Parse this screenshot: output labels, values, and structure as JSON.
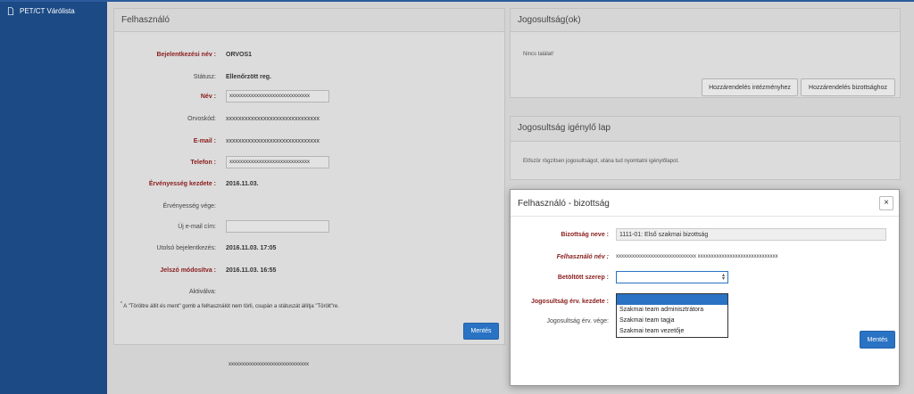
{
  "sidebar": {
    "items": [
      {
        "label": "PET/CT Várólista",
        "icon": "document-icon"
      }
    ]
  },
  "user_panel": {
    "title": "Felhasználó",
    "fields": [
      {
        "label": "Bejelentkezési név :",
        "value": "ORVOS1"
      },
      {
        "label": "Státusz:",
        "value": "Ellenőrzött reg."
      },
      {
        "label": "Név :",
        "value": "xxxxxxxxxxxxxxxxxxxxxxxxxxxxxx"
      },
      {
        "label": "Orvoskód:",
        "value": "xxxxxxxxxxxxxxxxxxxxxxxxxxxxxx"
      },
      {
        "label": "E-mail :",
        "value": "xxxxxxxxxxxxxxxxxxxxxxxxxxxxxx"
      },
      {
        "label": "Telefon :",
        "value": "xxxxxxxxxxxxxxxxxxxxxxxxxxxxxx"
      },
      {
        "label": "Érvényesség kezdete :",
        "value": "2016.11.03."
      },
      {
        "label": "Érvényesség vége:",
        "value": ""
      },
      {
        "label": "Új e-mail cím:",
        "value": ""
      },
      {
        "label": "Utolsó bejelentkezés:",
        "value": "2016.11.03. 17:05"
      },
      {
        "label": "Jelszó módosítva :",
        "value": "2016.11.03. 16:55"
      },
      {
        "label": "Aktiválva:",
        "value": ""
      }
    ],
    "footnote": "A \"Törölt­re állít és ment\" gomb a felhasználót nem törli, csupán a státuszát állítja \"Törölt\"re.",
    "footnote_star": "*",
    "save_button": "Mentés",
    "footer_text": "xxxxxxxxxxxxxxxxxxxxxxxxxxxxxx"
  },
  "rights_panel": {
    "title": "Jogosultság(ok)",
    "empty_text": "Nincs találat!",
    "assign_institution_button": "Hozzárendelés intézményhez",
    "assign_committee_button": "Hozzárendelés bizottsághoz"
  },
  "request_panel": {
    "title": "Jogosultság igénylő lap",
    "info_text": "Először rögzítsen jogosultságot, utána tud nyomtatni igénylőlapot."
  },
  "modal": {
    "title": "Felhasználó - bizottság",
    "close_symbol": "×",
    "fields": [
      {
        "label": "Bizottság neve :",
        "value": "1111-01: Első szakmai bizottság"
      },
      {
        "label": "Felhasználó név :",
        "value": "xxxxxxxxxxxxxxxxxxxxxxxxxxxxxx xxxxxxxxxxxxxxxxxxxxxxxxxxxxxx"
      },
      {
        "label": "Betöltött szerep :",
        "value": ""
      },
      {
        "label": "Jogosultság érv. kezdete :",
        "value": ""
      },
      {
        "label": "Jogosultság érv. vége:",
        "value": ""
      }
    ],
    "role_options": [
      "",
      "Szakmai team adminisztrátora",
      "Szakmai team tagja",
      "Szakmai team vezetője"
    ],
    "save_button": "Mentés"
  },
  "colors": {
    "sidebar": "#1b4a85",
    "primary": "#2a73c4",
    "required_label": "#8a1c1c"
  }
}
